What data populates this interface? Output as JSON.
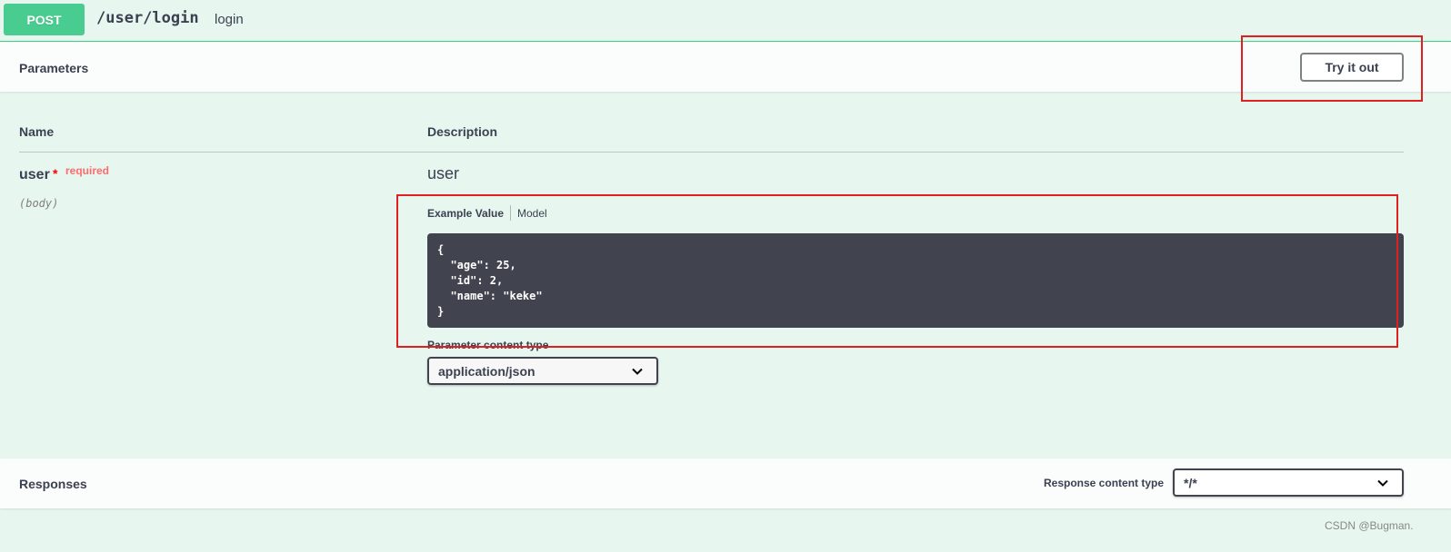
{
  "operation": {
    "method": "POST",
    "path": "/user/login",
    "summary": "login",
    "method_color": "#49cc90"
  },
  "parameters": {
    "title": "Parameters",
    "try_button": "Try it out",
    "col_name": "Name",
    "col_description": "Description",
    "items": [
      {
        "name": "user",
        "required_star": "*",
        "required_label": "required",
        "in": "(body)",
        "description": "user"
      }
    ],
    "tabs": {
      "example": "Example Value",
      "model": "Model"
    },
    "example_json": "{\n  \"age\": 25,\n  \"id\": 2,\n  \"name\": \"keke\"\n}",
    "content_type_label": "Parameter content type",
    "content_type_value": "application/json"
  },
  "responses": {
    "title": "Responses",
    "content_type_label": "Response content type",
    "content_type_value": "*/*"
  },
  "icons": {
    "select_chevron": "chevron-down-icon"
  },
  "annotation_color": "#e02020",
  "watermark": "CSDN @Bugman."
}
